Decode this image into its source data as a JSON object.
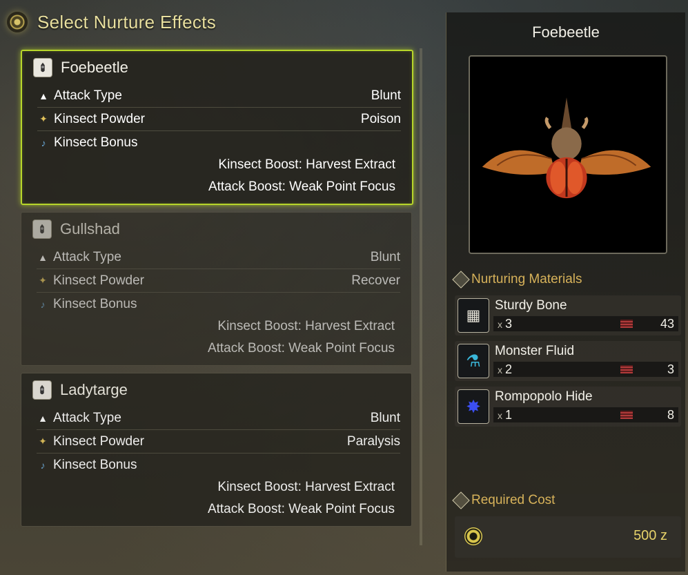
{
  "header": {
    "title": "Select Nurture Effects"
  },
  "labels": {
    "attack_type": "Attack Type",
    "kinsect_powder": "Kinsect Powder",
    "kinsect_bonus": "Kinsect Bonus"
  },
  "kinsects": [
    {
      "name": "Foebeetle",
      "attack_type": "Blunt",
      "kinsect_powder": "Poison",
      "bonuses": [
        "Kinsect Boost: Harvest Extract",
        "Attack Boost: Weak Point Focus"
      ],
      "selected": true
    },
    {
      "name": "Gullshad",
      "attack_type": "Blunt",
      "kinsect_powder": "Recover",
      "bonuses": [
        "Kinsect Boost: Harvest Extract",
        "Attack Boost: Weak Point Focus"
      ],
      "selected": false
    },
    {
      "name": "Ladytarge",
      "attack_type": "Blunt",
      "kinsect_powder": "Paralysis",
      "bonuses": [
        "Kinsect Boost: Harvest Extract",
        "Attack Boost: Weak Point Focus"
      ],
      "selected": false
    }
  ],
  "detail": {
    "name": "Foebeetle",
    "materials_title": "Nurturing Materials",
    "materials": [
      {
        "name": "Sturdy Bone",
        "required": "3",
        "owned": "43",
        "icon": "bone-icon"
      },
      {
        "name": "Monster Fluid",
        "required": "2",
        "owned": "3",
        "icon": "fluid-icon"
      },
      {
        "name": "Rompopolo Hide",
        "required": "1",
        "owned": "8",
        "icon": "hide-icon"
      }
    ],
    "qty_prefix": "x",
    "cost_title": "Required Cost",
    "cost_value": "500 z"
  },
  "colors": {
    "selected_border": "#b7d62a",
    "section_heading": "#d7b25a",
    "cost_text": "#e7d36a"
  }
}
